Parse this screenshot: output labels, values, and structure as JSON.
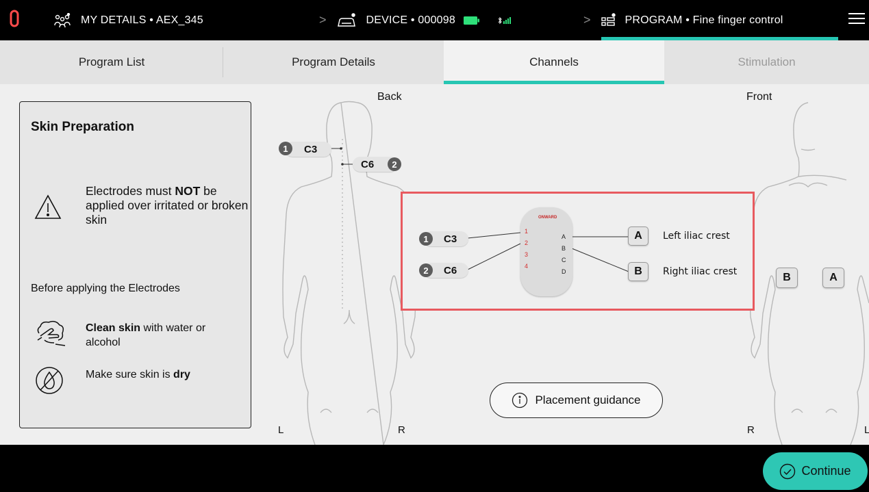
{
  "topbar": {
    "my_details": "MY DETAILS • AEX_345",
    "device": "DEVICE • 000098",
    "program": "PROGRAM • Fine finger control"
  },
  "tabs": [
    {
      "label": "Program List"
    },
    {
      "label": "Program Details"
    },
    {
      "label": "Channels"
    },
    {
      "label": "Stimulation"
    }
  ],
  "skin_card": {
    "title": "Skin Preparation",
    "warning_pre": "Electrodes must ",
    "warning_strong": "NOT",
    "warning_post": " be applied over irritated or broken skin",
    "before_label": "Before applying the Electrodes",
    "tip1_strong": "Clean skin",
    "tip1_rest": " with water or alcohol",
    "tip2_pre": "Make sure skin is ",
    "tip2_strong": "dry"
  },
  "back_view": {
    "label": "Back",
    "left": "L",
    "right": "R",
    "electrodes": [
      {
        "num": "1",
        "label": "C3"
      },
      {
        "num": "2",
        "label": "C6"
      }
    ]
  },
  "front_view": {
    "label": "Front",
    "left": "R",
    "right": "L",
    "electrodes": [
      {
        "label": "B"
      },
      {
        "label": "A"
      }
    ]
  },
  "diagram": {
    "inputs": [
      {
        "num": "1",
        "label": "C3"
      },
      {
        "num": "2",
        "label": "C6"
      }
    ],
    "device_brand": "ONWARD",
    "pins_numbers": [
      "1",
      "2",
      "3",
      "4"
    ],
    "pins_letters": [
      "A",
      "B",
      "C",
      "D"
    ],
    "outputs": [
      {
        "letter": "A",
        "location": "Left iliac crest"
      },
      {
        "letter": "B",
        "location": "Right iliac crest"
      }
    ]
  },
  "placement_button": "Placement guidance",
  "continue_button": "Continue",
  "colors": {
    "accent": "#27c6b3",
    "highlight_border": "#e85a5f",
    "battery": "#2ee07a"
  }
}
